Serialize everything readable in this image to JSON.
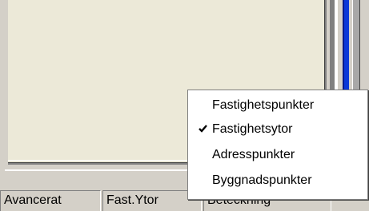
{
  "statusbar": {
    "cells": [
      {
        "label": "Avancerat"
      },
      {
        "label": "Fast.Ytor"
      },
      {
        "label": "Beteckning"
      }
    ]
  },
  "context_menu": {
    "items": [
      {
        "label": "Fastighetspunkter",
        "checked": false
      },
      {
        "label": "Fastighetsytor",
        "checked": true
      },
      {
        "label": "Adresspunkter",
        "checked": false
      },
      {
        "label": "Byggnadspunkter",
        "checked": false
      }
    ]
  },
  "colors": {
    "panel": "#ece9d8",
    "chrome": "#d4d0c8",
    "accent_blue": "#0a38d8"
  }
}
